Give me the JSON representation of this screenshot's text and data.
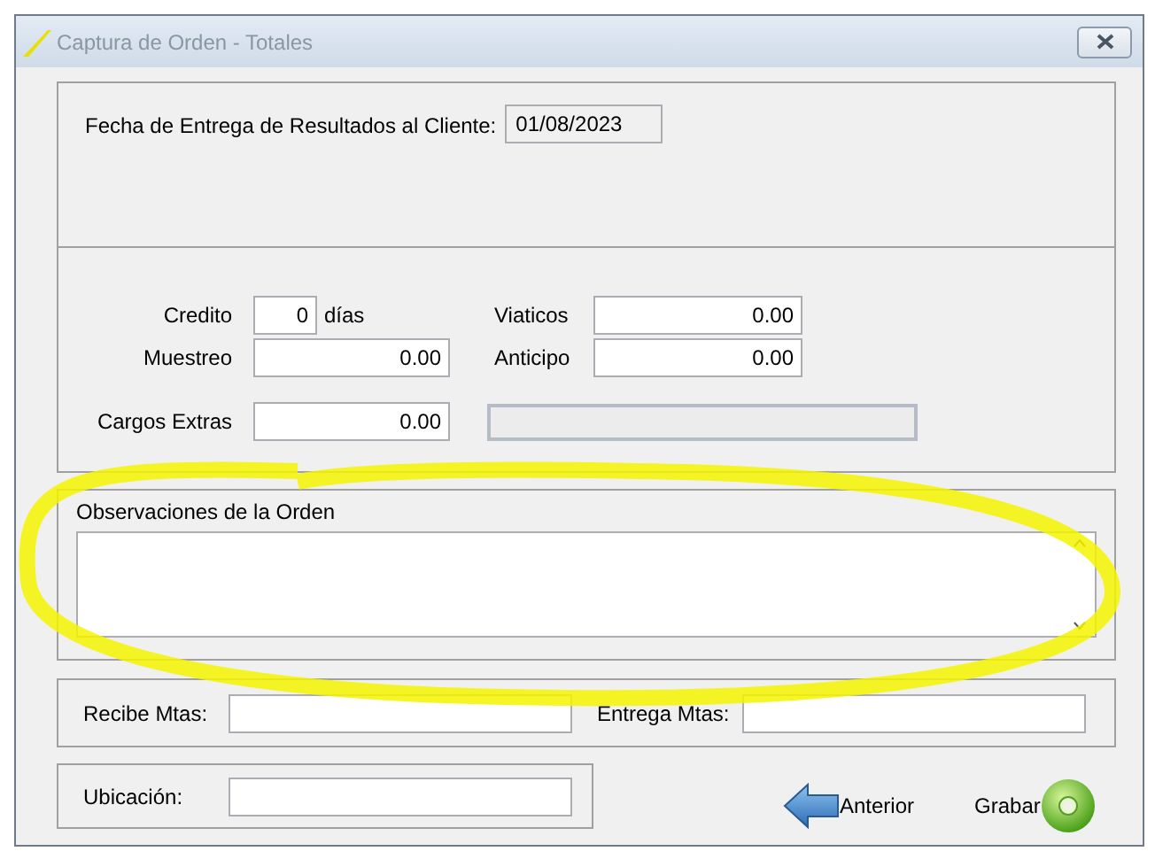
{
  "window": {
    "title": "Captura de Orden - Totales"
  },
  "delivery": {
    "label": "Fecha de Entrega de Resultados al Cliente:",
    "value": "01/08/2023"
  },
  "credit": {
    "label": "Credito",
    "value": "0",
    "unit": "días"
  },
  "viaticos": {
    "label": "Viaticos",
    "value": "0.00"
  },
  "muestreo": {
    "label": "Muestreo",
    "value": "0.00"
  },
  "anticipo": {
    "label": "Anticipo",
    "value": "0.00"
  },
  "cargos": {
    "label": "Cargos Extras",
    "value": "0.00"
  },
  "cargos_detail": {
    "disabled": true
  },
  "observations": {
    "label": "Observaciones de la Orden"
  },
  "receive": {
    "label": "Recibe Mtas:"
  },
  "deliver": {
    "label": "Entrega Mtas:"
  },
  "location": {
    "label": "Ubicación:"
  },
  "buttons": [
    {
      "kind": "back",
      "label": "Anterior"
    },
    {
      "kind": "save",
      "label": "Grabar"
    }
  ]
}
